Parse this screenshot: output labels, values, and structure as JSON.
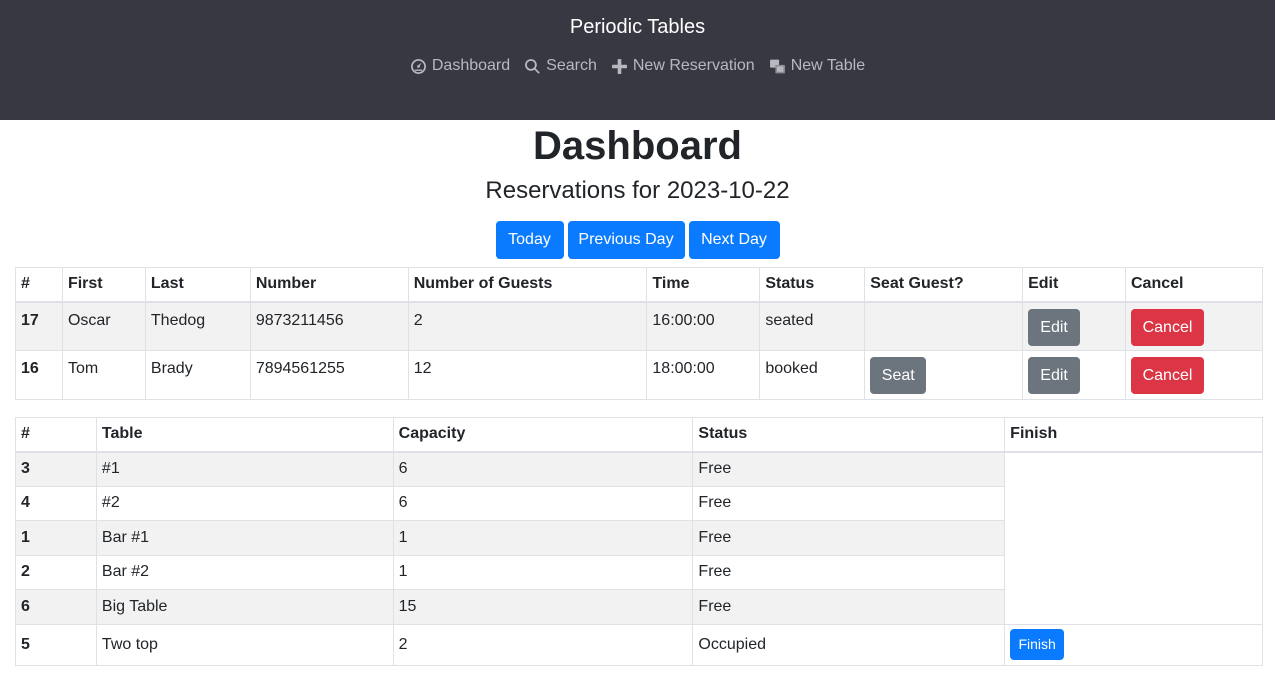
{
  "header": {
    "brand": "Periodic Tables",
    "nav": [
      {
        "label": "Dashboard",
        "icon": "dashboard-icon"
      },
      {
        "label": "Search",
        "icon": "search-icon"
      },
      {
        "label": "New Reservation",
        "icon": "plus-icon"
      },
      {
        "label": "New Table",
        "icon": "layers-icon"
      }
    ]
  },
  "main": {
    "title": "Dashboard",
    "subtitle": "Reservations for 2023-10-22",
    "buttons": {
      "today": "Today",
      "previous": "Previous Day",
      "next": "Next Day"
    }
  },
  "reservations": {
    "headers": [
      "#",
      "First",
      "Last",
      "Number",
      "Number of Guests",
      "Time",
      "Status",
      "Seat Guest?",
      "Edit",
      "Cancel"
    ],
    "rows": [
      {
        "id": "17",
        "first": "Oscar",
        "last": "Thedog",
        "number": "9873211456",
        "guests": "2",
        "time": "16:00:00",
        "status": "seated",
        "seat_label": "",
        "edit_label": "Edit",
        "cancel_label": "Cancel"
      },
      {
        "id": "16",
        "first": "Tom",
        "last": "Brady",
        "number": "7894561255",
        "guests": "12",
        "time": "18:00:00",
        "status": "booked",
        "seat_label": "Seat",
        "edit_label": "Edit",
        "cancel_label": "Cancel"
      }
    ]
  },
  "tables": {
    "headers": [
      "#",
      "Table",
      "Capacity",
      "Status",
      "Finish"
    ],
    "rows": [
      {
        "id": "3",
        "name": "#1",
        "capacity": "6",
        "status": "Free"
      },
      {
        "id": "4",
        "name": "#2",
        "capacity": "6",
        "status": "Free"
      },
      {
        "id": "1",
        "name": "Bar #1",
        "capacity": "1",
        "status": "Free"
      },
      {
        "id": "2",
        "name": "Bar #2",
        "capacity": "1",
        "status": "Free"
      },
      {
        "id": "6",
        "name": "Big Table",
        "capacity": "15",
        "status": "Free"
      },
      {
        "id": "5",
        "name": "Two top",
        "capacity": "2",
        "status": "Occupied",
        "finish_label": "Finish"
      }
    ]
  },
  "colors": {
    "header_bg": "#383843",
    "primary": "#0a7bff",
    "secondary": "#6c757d",
    "danger": "#dc3545"
  }
}
